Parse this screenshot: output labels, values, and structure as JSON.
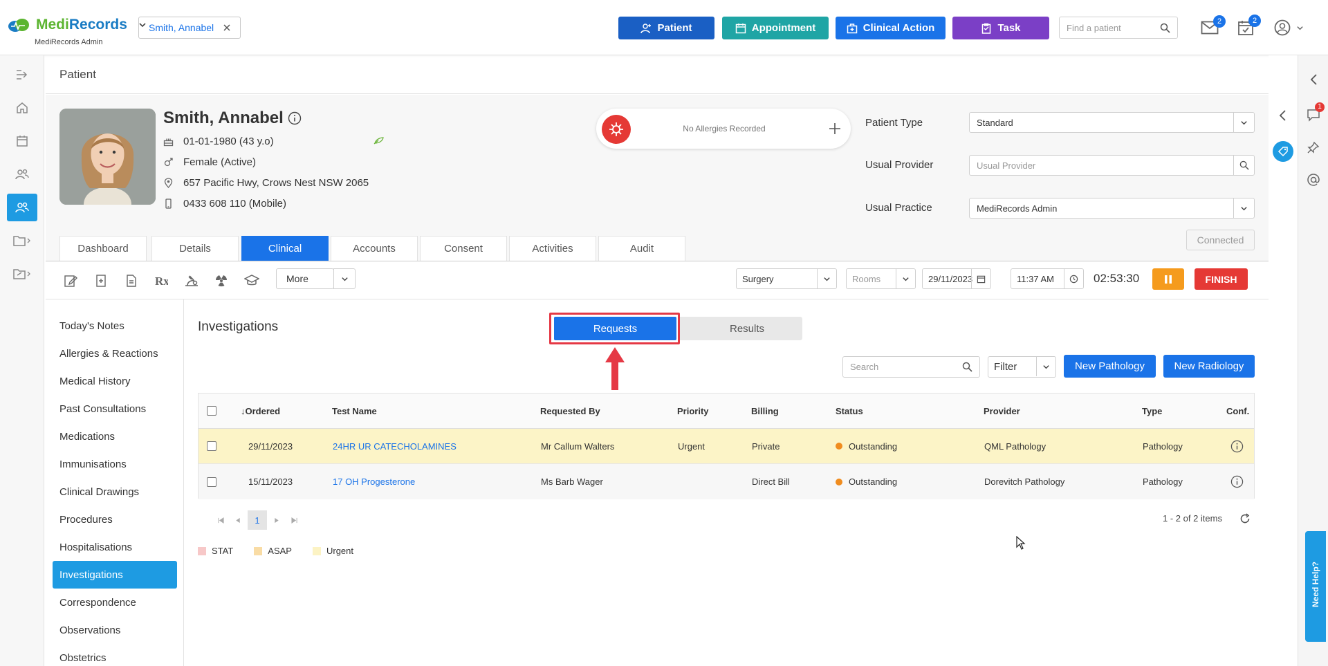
{
  "header": {
    "logo_medi": "Medi",
    "logo_records": "Records",
    "logo_sub": "MediRecords Admin",
    "patient_chip": "Smith, Annabel",
    "buttons": [
      {
        "label": "Patient",
        "color": "#1a5fc4"
      },
      {
        "label": "Appointment",
        "color": "#1fa5a5"
      },
      {
        "label": "Clinical Action",
        "color": "#1a73e8"
      },
      {
        "label": "Task",
        "color": "#7b3fc6"
      }
    ],
    "search_placeholder": "Find a patient",
    "mail_badge": "2",
    "tasks_badge": "2"
  },
  "page_title": "Patient",
  "patient": {
    "name": "Smith, Annabel",
    "dob": "01-01-1980 (43 y.o)",
    "gender": "Female (Active)",
    "address": "657 Pacific Hwy, Crows Nest NSW 2065",
    "phone": "0433 608 110 (Mobile)",
    "allergies": "No Allergies Recorded"
  },
  "patient_form": {
    "type_label": "Patient Type",
    "type_value": "Standard",
    "provider_label": "Usual Provider",
    "provider_placeholder": "Usual Provider",
    "practice_label": "Usual Practice",
    "practice_value": "MediRecords Admin",
    "connected": "Connected"
  },
  "tabs": [
    "Dashboard",
    "Details",
    "Clinical",
    "Accounts",
    "Consent",
    "Activities",
    "Audit"
  ],
  "active_tab": "Clinical",
  "toolbar": {
    "more": "More",
    "location": "Surgery",
    "rooms": "Rooms",
    "date": "29/11/2023",
    "time": "11:37 AM",
    "timer": "02:53:30",
    "finish": "FINISH"
  },
  "clinical_nav": [
    "Today's Notes",
    "Allergies & Reactions",
    "Medical History",
    "Past Consultations",
    "Medications",
    "Immunisations",
    "Clinical Drawings",
    "Procedures",
    "Hospitalisations",
    "Investigations",
    "Correspondence",
    "Observations",
    "Obstetrics"
  ],
  "active_nav": "Investigations",
  "investigations": {
    "title": "Investigations",
    "seg_requests": "Requests",
    "seg_results": "Results",
    "search_placeholder": "Search",
    "filter": "Filter",
    "new_pathology": "New Pathology",
    "new_radiology": "New Radiology",
    "columns": {
      "ordered": "↓Ordered",
      "test": "Test Name",
      "requested_by": "Requested By",
      "priority": "Priority",
      "billing": "Billing",
      "status": "Status",
      "provider": "Provider",
      "type": "Type",
      "conf": "Conf."
    },
    "rows": [
      {
        "ordered": "29/11/2023",
        "test": "24HR UR CATECHOLAMINES",
        "requested_by": "Mr Callum Walters",
        "priority": "Urgent",
        "billing": "Private",
        "status": "Outstanding",
        "provider": "QML Pathology",
        "type": "Pathology"
      },
      {
        "ordered": "15/11/2023",
        "test": "17 OH Progesterone",
        "requested_by": "Ms Barb Wager",
        "priority": "",
        "billing": "Direct Bill",
        "status": "Outstanding",
        "provider": "Dorevitch Pathology",
        "type": "Pathology"
      }
    ],
    "page": "1",
    "items_count": "1 - 2 of 2 items",
    "legend": [
      {
        "label": "STAT",
        "color": "#f7c8c8"
      },
      {
        "label": "ASAP",
        "color": "#f9dca5"
      },
      {
        "label": "Urgent",
        "color": "#fcf3c4"
      }
    ]
  },
  "help_tab": "Need Help?",
  "notification_badge": "1"
}
